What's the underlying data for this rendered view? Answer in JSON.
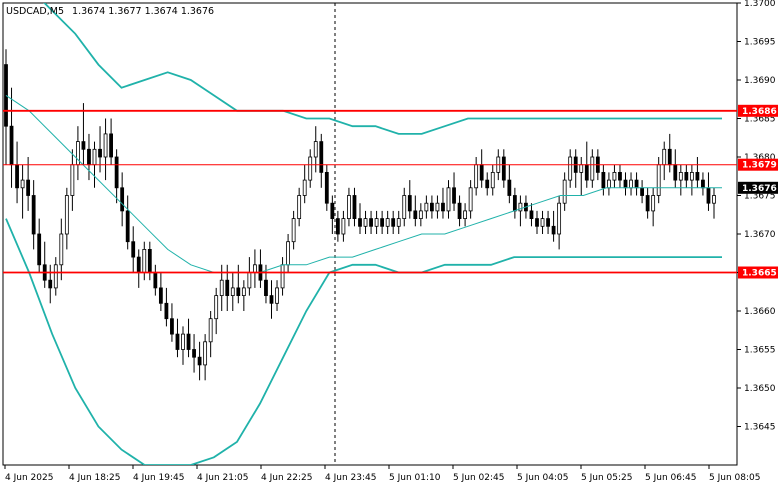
{
  "chart_data": {
    "type": "candlestick",
    "title": "USDCAD,M5",
    "ohlc_header": "1.3674 1.3677 1.3674 1.3676",
    "colors": {
      "background": "#ffffff",
      "candle": "#000000",
      "bollinger": "#20b2aa",
      "horizontal_lines": "#ff0000",
      "level_label_bg": "#ff0000",
      "current_price_bg": "#000000"
    },
    "ylim": [
      1.364,
      1.37
    ],
    "y_ticks": [
      "1.3700",
      "1.3695",
      "1.3690",
      "1.3685",
      "1.3680",
      "1.3675",
      "1.3670",
      "1.3665",
      "1.3660",
      "1.3655",
      "1.3650",
      "1.3645"
    ],
    "x_ticks": [
      "4 Jun 2025",
      "4 Jun 18:25",
      "4 Jun 19:45",
      "4 Jun 21:05",
      "4 Jun 22:25",
      "4 Jun 23:45",
      "5 Jun 01:10",
      "5 Jun 02:45",
      "5 Jun 04:05",
      "5 Jun 05:25",
      "5 Jun 06:45",
      "5 Jun 08:05"
    ],
    "horizontal_levels": [
      {
        "value": 1.3686,
        "label": "1.3686"
      },
      {
        "value": 1.3679,
        "label": "1.3679"
      },
      {
        "value": 1.3665,
        "label": "1.3665"
      }
    ],
    "current_price": {
      "value": 1.3676,
      "label": "1.3676"
    },
    "candles": [
      [
        1.3692,
        1.3694,
        1.3679,
        1.3684
      ],
      [
        1.3684,
        1.3689,
        1.3676,
        1.3679
      ],
      [
        1.3679,
        1.3682,
        1.3674,
        1.3676
      ],
      [
        1.3676,
        1.3679,
        1.3672,
        1.3677
      ],
      [
        1.3677,
        1.368,
        1.3673,
        1.3675
      ],
      [
        1.3675,
        1.3677,
        1.3668,
        1.367
      ],
      [
        1.367,
        1.3672,
        1.3665,
        1.3666
      ],
      [
        1.3666,
        1.3669,
        1.3663,
        1.3664
      ],
      [
        1.3664,
        1.3666,
        1.3661,
        1.3663
      ],
      [
        1.3663,
        1.3667,
        1.3662,
        1.3666
      ],
      [
        1.3666,
        1.3672,
        1.3664,
        1.367
      ],
      [
        1.367,
        1.3676,
        1.3668,
        1.3675
      ],
      [
        1.3675,
        1.3681,
        1.3673,
        1.3679
      ],
      [
        1.3679,
        1.3684,
        1.3677,
        1.3682
      ],
      [
        1.3682,
        1.3687,
        1.3679,
        1.3681
      ],
      [
        1.3681,
        1.3683,
        1.3677,
        1.3679
      ],
      [
        1.3679,
        1.3682,
        1.3676,
        1.3681
      ],
      [
        1.3681,
        1.3684,
        1.3678,
        1.368
      ],
      [
        1.368,
        1.3685,
        1.3677,
        1.3683
      ],
      [
        1.3683,
        1.3685,
        1.3679,
        1.368
      ],
      [
        1.368,
        1.3681,
        1.3674,
        1.3676
      ],
      [
        1.3676,
        1.3678,
        1.3671,
        1.3673
      ],
      [
        1.3673,
        1.3675,
        1.3668,
        1.3669
      ],
      [
        1.3669,
        1.3671,
        1.3665,
        1.3667
      ],
      [
        1.3667,
        1.3668,
        1.3663,
        1.3665
      ],
      [
        1.3665,
        1.3669,
        1.3664,
        1.3668
      ],
      [
        1.3668,
        1.3669,
        1.3664,
        1.3665
      ],
      [
        1.3665,
        1.3666,
        1.3662,
        1.3663
      ],
      [
        1.3663,
        1.3665,
        1.366,
        1.3661
      ],
      [
        1.3661,
        1.3663,
        1.3658,
        1.3659
      ],
      [
        1.3659,
        1.3661,
        1.3656,
        1.3657
      ],
      [
        1.3657,
        1.3659,
        1.3654,
        1.3655
      ],
      [
        1.3655,
        1.3658,
        1.3653,
        1.3657
      ],
      [
        1.3657,
        1.3659,
        1.3654,
        1.3655
      ],
      [
        1.3655,
        1.3657,
        1.3652,
        1.3654
      ],
      [
        1.3654,
        1.3656,
        1.3651,
        1.3653
      ],
      [
        1.3653,
        1.3657,
        1.3651,
        1.3656
      ],
      [
        1.3656,
        1.366,
        1.3654,
        1.3659
      ],
      [
        1.3659,
        1.3663,
        1.3657,
        1.3662
      ],
      [
        1.3662,
        1.3666,
        1.366,
        1.3664
      ],
      [
        1.3664,
        1.3666,
        1.366,
        1.3662
      ],
      [
        1.3662,
        1.3665,
        1.366,
        1.3663
      ],
      [
        1.3663,
        1.3666,
        1.3661,
        1.3662
      ],
      [
        1.3662,
        1.3664,
        1.366,
        1.3663
      ],
      [
        1.3663,
        1.3667,
        1.3662,
        1.3665
      ],
      [
        1.3665,
        1.3668,
        1.3663,
        1.3666
      ],
      [
        1.3666,
        1.3668,
        1.3663,
        1.3664
      ],
      [
        1.3664,
        1.3666,
        1.3661,
        1.3662
      ],
      [
        1.3662,
        1.3664,
        1.3659,
        1.3661
      ],
      [
        1.3661,
        1.3664,
        1.366,
        1.3663
      ],
      [
        1.3663,
        1.3667,
        1.3662,
        1.3666
      ],
      [
        1.3666,
        1.367,
        1.3665,
        1.3669
      ],
      [
        1.3669,
        1.3673,
        1.3668,
        1.3672
      ],
      [
        1.3672,
        1.3676,
        1.3671,
        1.3675
      ],
      [
        1.3675,
        1.3679,
        1.3674,
        1.3677
      ],
      [
        1.3677,
        1.3681,
        1.3676,
        1.368
      ],
      [
        1.368,
        1.3684,
        1.3678,
        1.3682
      ],
      [
        1.3682,
        1.3683,
        1.3676,
        1.3678
      ],
      [
        1.3678,
        1.3679,
        1.3673,
        1.3674
      ],
      [
        1.3674,
        1.3675,
        1.367,
        1.3672
      ],
      [
        1.3672,
        1.3673,
        1.3669,
        1.367
      ],
      [
        1.367,
        1.3673,
        1.3669,
        1.3672
      ],
      [
        1.3672,
        1.3676,
        1.3671,
        1.3675
      ],
      [
        1.3675,
        1.3676,
        1.3671,
        1.3672
      ],
      [
        1.3672,
        1.3674,
        1.367,
        1.3671
      ],
      [
        1.3671,
        1.3673,
        1.367,
        1.3672
      ],
      [
        1.3672,
        1.3673,
        1.367,
        1.3671
      ],
      [
        1.3671,
        1.3673,
        1.367,
        1.3672
      ],
      [
        1.3672,
        1.3673,
        1.367,
        1.3671
      ],
      [
        1.3671,
        1.3673,
        1.367,
        1.3672
      ],
      [
        1.3672,
        1.3673,
        1.367,
        1.3671
      ],
      [
        1.3671,
        1.3673,
        1.367,
        1.3672
      ],
      [
        1.3672,
        1.3676,
        1.3671,
        1.3675
      ],
      [
        1.3675,
        1.3677,
        1.3672,
        1.3673
      ],
      [
        1.3673,
        1.3675,
        1.3671,
        1.3672
      ],
      [
        1.3672,
        1.3674,
        1.3671,
        1.3673
      ],
      [
        1.3673,
        1.3675,
        1.3672,
        1.3674
      ],
      [
        1.3674,
        1.3675,
        1.3672,
        1.3673
      ],
      [
        1.3673,
        1.3675,
        1.3672,
        1.3674
      ],
      [
        1.3674,
        1.3676,
        1.3672,
        1.3673
      ],
      [
        1.3673,
        1.3677,
        1.3672,
        1.3676
      ],
      [
        1.3676,
        1.3678,
        1.3673,
        1.3674
      ],
      [
        1.3674,
        1.3675,
        1.3671,
        1.3672
      ],
      [
        1.3672,
        1.3674,
        1.3671,
        1.3673
      ],
      [
        1.3673,
        1.3677,
        1.3672,
        1.3676
      ],
      [
        1.3676,
        1.368,
        1.3675,
        1.3679
      ],
      [
        1.3679,
        1.3681,
        1.3676,
        1.3677
      ],
      [
        1.3677,
        1.3678,
        1.3675,
        1.3676
      ],
      [
        1.3676,
        1.3679,
        1.3675,
        1.3678
      ],
      [
        1.3678,
        1.3681,
        1.3677,
        1.368
      ],
      [
        1.368,
        1.3681,
        1.3676,
        1.3677
      ],
      [
        1.3677,
        1.3679,
        1.3674,
        1.3675
      ],
      [
        1.3675,
        1.3676,
        1.3672,
        1.3673
      ],
      [
        1.3673,
        1.3675,
        1.3671,
        1.3674
      ],
      [
        1.3674,
        1.3675,
        1.3672,
        1.3673
      ],
      [
        1.3673,
        1.3674,
        1.3671,
        1.3672
      ],
      [
        1.3672,
        1.3673,
        1.367,
        1.3671
      ],
      [
        1.3671,
        1.3673,
        1.367,
        1.3672
      ],
      [
        1.3672,
        1.3673,
        1.367,
        1.3671
      ],
      [
        1.3671,
        1.3673,
        1.3669,
        1.367
      ],
      [
        1.367,
        1.3675,
        1.3668,
        1.3674
      ],
      [
        1.3674,
        1.3678,
        1.3673,
        1.3677
      ],
      [
        1.3677,
        1.3681,
        1.3676,
        1.368
      ],
      [
        1.368,
        1.3681,
        1.3676,
        1.3678
      ],
      [
        1.3678,
        1.368,
        1.3675,
        1.3679
      ],
      [
        1.3679,
        1.3682,
        1.3676,
        1.3677
      ],
      [
        1.3677,
        1.3681,
        1.3676,
        1.368
      ],
      [
        1.368,
        1.3681,
        1.3677,
        1.3678
      ],
      [
        1.3678,
        1.3679,
        1.3675,
        1.3676
      ],
      [
        1.3676,
        1.3678,
        1.3675,
        1.3677
      ],
      [
        1.3677,
        1.3679,
        1.3676,
        1.3678
      ],
      [
        1.3678,
        1.3679,
        1.3676,
        1.3677
      ],
      [
        1.3677,
        1.3678,
        1.3675,
        1.3676
      ],
      [
        1.3676,
        1.3678,
        1.3675,
        1.3677
      ],
      [
        1.3677,
        1.3678,
        1.3675,
        1.3676
      ],
      [
        1.3676,
        1.3677,
        1.3674,
        1.3675
      ],
      [
        1.3675,
        1.3676,
        1.3672,
        1.3673
      ],
      [
        1.3673,
        1.3676,
        1.3671,
        1.3675
      ],
      [
        1.3675,
        1.368,
        1.3674,
        1.3679
      ],
      [
        1.3679,
        1.3682,
        1.3677,
        1.3681
      ],
      [
        1.3681,
        1.3683,
        1.3678,
        1.3679
      ],
      [
        1.3679,
        1.3681,
        1.3676,
        1.3677
      ],
      [
        1.3677,
        1.3679,
        1.3675,
        1.3678
      ],
      [
        1.3678,
        1.3679,
        1.3676,
        1.3677
      ],
      [
        1.3677,
        1.3679,
        1.3675,
        1.3678
      ],
      [
        1.3678,
        1.368,
        1.3676,
        1.3677
      ],
      [
        1.3677,
        1.3678,
        1.3675,
        1.3676
      ],
      [
        1.3676,
        1.3678,
        1.3673,
        1.3674
      ],
      [
        1.3674,
        1.3676,
        1.3672,
        1.3675
      ]
    ],
    "bollinger": {
      "middle": [
        1.3688,
        1.3686,
        1.3683,
        1.368,
        1.3677,
        1.3674,
        1.3671,
        1.3668,
        1.3666,
        1.3665,
        1.3665,
        1.3665,
        1.3666,
        1.3666,
        1.3667,
        1.3667,
        1.3668,
        1.3669,
        1.367,
        1.367,
        1.3671,
        1.3672,
        1.3673,
        1.3674,
        1.3675,
        1.3675,
        1.3676,
        1.3676,
        1.3676,
        1.3676,
        1.3676,
        1.3676
      ],
      "upper": [
        1.3704,
        1.3702,
        1.3699,
        1.3696,
        1.3692,
        1.3689,
        1.369,
        1.3691,
        1.369,
        1.3688,
        1.3686,
        1.3686,
        1.3686,
        1.3685,
        1.3685,
        1.3684,
        1.3684,
        1.3683,
        1.3683,
        1.3684,
        1.3685,
        1.3685,
        1.3685,
        1.3685,
        1.3685,
        1.3685,
        1.3685,
        1.3685,
        1.3685,
        1.3685,
        1.3685,
        1.3685
      ],
      "lower": [
        1.3672,
        1.3665,
        1.3657,
        1.365,
        1.3645,
        1.3642,
        1.364,
        1.364,
        1.364,
        1.3641,
        1.3643,
        1.3648,
        1.3654,
        1.366,
        1.3665,
        1.3666,
        1.3666,
        1.3665,
        1.3665,
        1.3666,
        1.3666,
        1.3666,
        1.3667,
        1.3667,
        1.3667,
        1.3667,
        1.3667,
        1.3667,
        1.3667,
        1.3667,
        1.3667,
        1.3667
      ]
    }
  }
}
